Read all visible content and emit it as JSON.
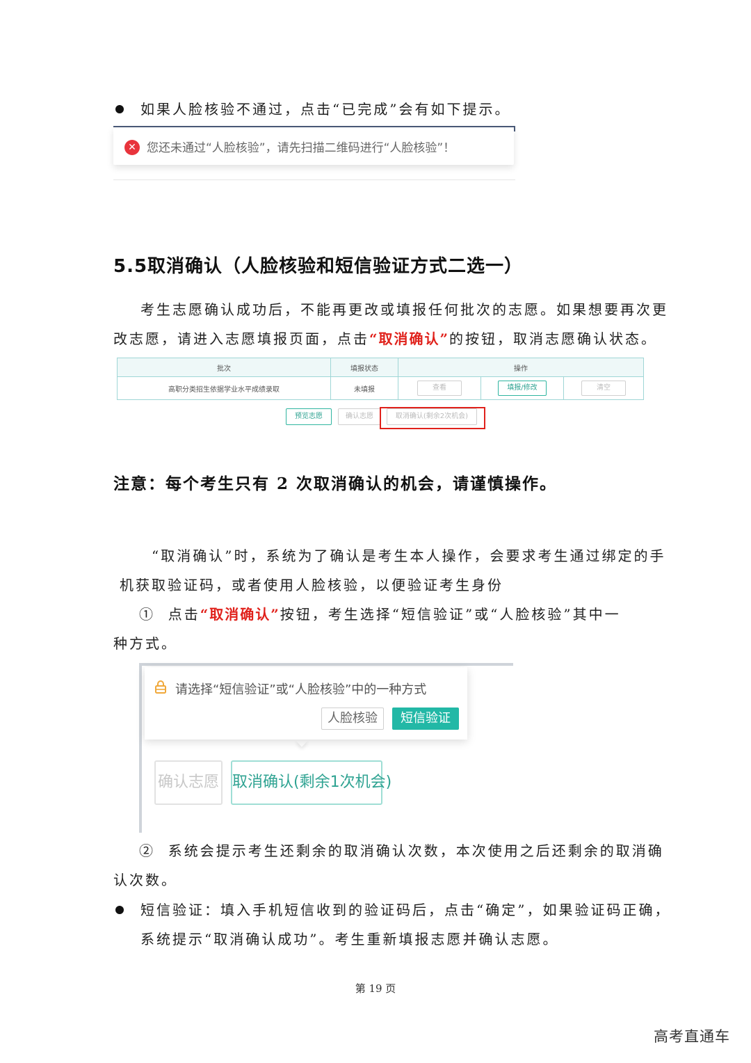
{
  "section_top": {
    "bullet_text": "如果人脸核验不通过，点击“已完成”会有如下提示。",
    "error_toast": {
      "icon": "close-circle-icon",
      "text": "您还未通过“人脸核验”，请先扫描二维码进行“人脸核验”！"
    }
  },
  "heading": "5.5取消确认（人脸核验和短信验证方式二选一）",
  "intro": {
    "line1": "考生志愿确认成功后，不能再更改或填报任何批次的志愿。如果想要再次更",
    "line2_a": "改志愿，请进入志愿填报页面，点击",
    "line2_red": "“取消确认”",
    "line2_b": "的按钮，取消志愿确认状态。"
  },
  "table": {
    "headers": [
      "批次",
      "填报状态",
      "操作"
    ],
    "row": {
      "batch": "高职分类招生依据学业水平成绩录取",
      "status": "未填报",
      "actions": [
        "查看",
        "填报/修改",
        "清空"
      ]
    },
    "buttons": [
      "预览志愿",
      "确认志愿",
      "取消确认(剩余2次机会)"
    ]
  },
  "notice": "注意：每个考生只有 2 次取消确认的机会，请谨慎操作。",
  "para2": {
    "line1": "“取消确认”时，系统为了确认是考生本人操作，会要求考生通过绑定的手",
    "line2": "机获取验证码，或者使用人脸核验，以便验证考生身份"
  },
  "step1": {
    "num": "①",
    "a": "点击",
    "red": "“取消确认”",
    "b": "按钮，考生选择“短信验证”或“人脸核验”其中一",
    "line2": "种方式。"
  },
  "popover": {
    "icon": "lock-icon",
    "text": "请选择“短信验证”或“人脸核验”中的一种方式",
    "btn_face": "人脸核验",
    "btn_sms": "短信验证",
    "btn_confirm": "确认志愿",
    "btn_cancel": "取消确认(剩余1次机会)"
  },
  "step2": {
    "num": "②",
    "line1": "系统会提示考生还剩余的取消确认次数，本次使用之后还剩余的取消确",
    "line2": "认次数。"
  },
  "bullet2": {
    "line1": "短信验证：填入手机短信收到的验证码后，点击“确定”，如果验证码正确，",
    "line2": "系统提示“取消确认成功”。考生重新填报志愿并确认志愿。"
  },
  "footer": "第 19 页",
  "watermark": "高考直通车",
  "colors": {
    "red": "#e0211b",
    "teal": "#22b8a6"
  }
}
